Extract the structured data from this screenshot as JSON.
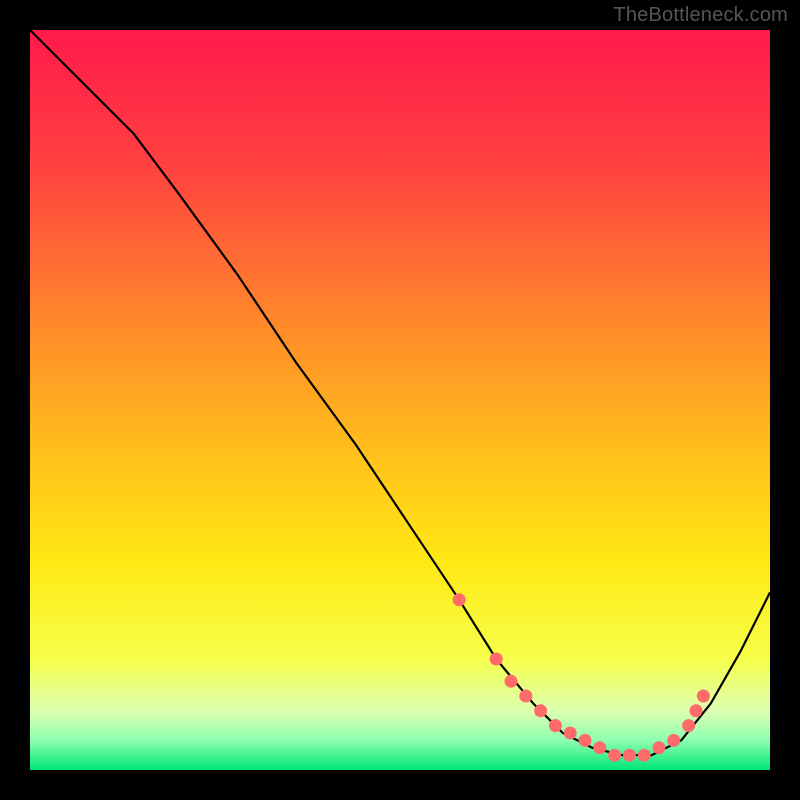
{
  "watermark": "TheBottleneck.com",
  "chart_data": {
    "type": "line",
    "title": "",
    "xlabel": "",
    "ylabel": "",
    "xlim": [
      0,
      100
    ],
    "ylim": [
      0,
      100
    ],
    "gradient_stops": [
      {
        "offset": 0,
        "color": "#ff1a4b"
      },
      {
        "offset": 18,
        "color": "#ff4040"
      },
      {
        "offset": 40,
        "color": "#ff8a2a"
      },
      {
        "offset": 58,
        "color": "#ffc21a"
      },
      {
        "offset": 72,
        "color": "#ffe914"
      },
      {
        "offset": 85,
        "color": "#f6ff4a"
      },
      {
        "offset": 92,
        "color": "#dcffb0"
      },
      {
        "offset": 96,
        "color": "#8dffb0"
      },
      {
        "offset": 100,
        "color": "#00e676"
      }
    ],
    "series": [
      {
        "name": "bottleneck-curve",
        "x": [
          0,
          8,
          14,
          20,
          28,
          36,
          44,
          52,
          58,
          63,
          68,
          72,
          76,
          80,
          84,
          88,
          92,
          96,
          100
        ],
        "y": [
          100,
          92,
          86,
          78,
          67,
          55,
          44,
          32,
          23,
          15,
          9,
          5,
          3,
          2,
          2,
          4,
          9,
          16,
          24
        ]
      }
    ],
    "markers": {
      "name": "highlight-points",
      "color": "#ff6b6b",
      "x": [
        58,
        63,
        65,
        67,
        69,
        71,
        73,
        75,
        77,
        79,
        81,
        83,
        85,
        87,
        89,
        90,
        91
      ],
      "y": [
        23,
        15,
        12,
        10,
        8,
        6,
        5,
        4,
        3,
        2,
        2,
        2,
        3,
        4,
        6,
        8,
        10
      ]
    }
  }
}
